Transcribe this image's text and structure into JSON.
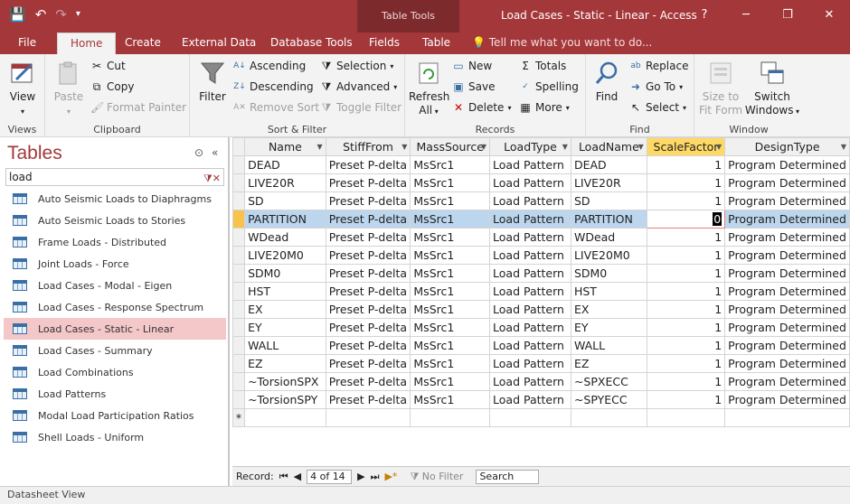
{
  "window": {
    "title": "Load Cases - Static - Linear - Access",
    "help": "?",
    "minimize": "─",
    "restore": "❐",
    "close": "✕"
  },
  "qat": {
    "save": "💾",
    "undo": "↶",
    "redo": "↷",
    "more": "▾"
  },
  "context_tab_title": "Table Tools",
  "tabs": [
    "File",
    "Home",
    "Create",
    "External Data",
    "Database Tools",
    "Fields",
    "Table"
  ],
  "tell_me": "Tell me what you want to do...",
  "ribbon": {
    "views": {
      "label": "Views",
      "view": "View"
    },
    "clipboard": {
      "label": "Clipboard",
      "paste": "Paste",
      "cut": "Cut",
      "copy": "Copy",
      "format_painter": "Format Painter"
    },
    "sort_filter": {
      "label": "Sort & Filter",
      "filter": "Filter",
      "ascending": "Ascending",
      "descending": "Descending",
      "remove_sort": "Remove Sort",
      "selection": "Selection",
      "advanced": "Advanced",
      "toggle_filter": "Toggle Filter"
    },
    "records": {
      "label": "Records",
      "refresh": "Refresh",
      "refresh2": "All",
      "new": "New",
      "save": "Save",
      "delete": "Delete",
      "totals": "Totals",
      "spelling": "Spelling",
      "more": "More"
    },
    "find": {
      "label": "Find",
      "find": "Find",
      "replace": "Replace",
      "goto": "Go To",
      "select": "Select"
    },
    "window": {
      "label": "Window",
      "size_to": "Size to",
      "fit_form": "Fit Form",
      "switch": "Switch",
      "windows": "Windows"
    }
  },
  "nav": {
    "title": "Tables",
    "search_value": "load",
    "items": [
      "Auto Seismic Loads to Diaphragms",
      "Auto Seismic Loads to Stories",
      "Frame Loads - Distributed",
      "Joint Loads - Force",
      "Load Cases - Modal - Eigen",
      "Load Cases - Response Spectrum",
      "Load Cases - Static - Linear",
      "Load Cases - Summary",
      "Load Combinations",
      "Load Patterns",
      "Modal Load Participation Ratios",
      "Shell Loads - Uniform"
    ]
  },
  "grid": {
    "columns": [
      "Name",
      "StiffFrom",
      "MassSource",
      "LoadType",
      "LoadName",
      "ScaleFactor",
      "DesignType"
    ],
    "rows": [
      [
        "DEAD",
        "Preset P-delta",
        "MsSrc1",
        "Load Pattern",
        "DEAD",
        "1",
        "Program Determined"
      ],
      [
        "LIVE20R",
        "Preset P-delta",
        "MsSrc1",
        "Load Pattern",
        "LIVE20R",
        "1",
        "Program Determined"
      ],
      [
        "SD",
        "Preset P-delta",
        "MsSrc1",
        "Load Pattern",
        "SD",
        "1",
        "Program Determined"
      ],
      [
        "PARTITION",
        "Preset P-delta",
        "MsSrc1",
        "Load Pattern",
        "PARTITION",
        "0",
        "Program Determined"
      ],
      [
        "WDead",
        "Preset P-delta",
        "MsSrc1",
        "Load Pattern",
        "WDead",
        "1",
        "Program Determined"
      ],
      [
        "LIVE20M0",
        "Preset P-delta",
        "MsSrc1",
        "Load Pattern",
        "LIVE20M0",
        "1",
        "Program Determined"
      ],
      [
        "SDM0",
        "Preset P-delta",
        "MsSrc1",
        "Load Pattern",
        "SDM0",
        "1",
        "Program Determined"
      ],
      [
        "HST",
        "Preset P-delta",
        "MsSrc1",
        "Load Pattern",
        "HST",
        "1",
        "Program Determined"
      ],
      [
        "EX",
        "Preset P-delta",
        "MsSrc1",
        "Load Pattern",
        "EX",
        "1",
        "Program Determined"
      ],
      [
        "EY",
        "Preset P-delta",
        "MsSrc1",
        "Load Pattern",
        "EY",
        "1",
        "Program Determined"
      ],
      [
        "WALL",
        "Preset P-delta",
        "MsSrc1",
        "Load Pattern",
        "WALL",
        "1",
        "Program Determined"
      ],
      [
        "EZ",
        "Preset P-delta",
        "MsSrc1",
        "Load Pattern",
        "EZ",
        "1",
        "Program Determined"
      ],
      [
        "~TorsionSPX",
        "Preset P-delta",
        "MsSrc1",
        "Load Pattern",
        "~SPXECC",
        "1",
        "Program Determined"
      ],
      [
        "~TorsionSPY",
        "Preset P-delta",
        "MsSrc1",
        "Load Pattern",
        "~SPYECC",
        "1",
        "Program Determined"
      ]
    ],
    "new_row_marker": "*"
  },
  "record_nav": {
    "label": "Record:",
    "first": "⏮",
    "prev": "◀",
    "position": "4 of 14",
    "next": "▶",
    "last": "⏭",
    "new": "▶*",
    "filter": "No Filter",
    "search": "Search"
  },
  "status": "Datasheet View"
}
